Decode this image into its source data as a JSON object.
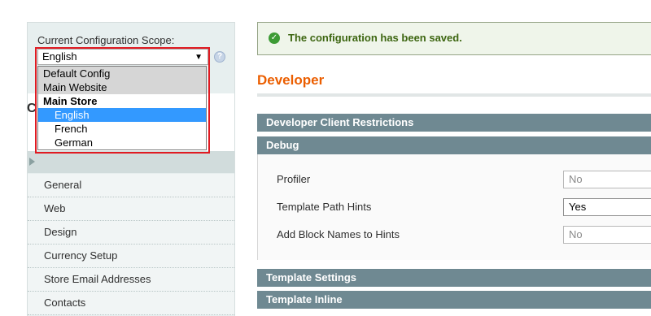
{
  "scope": {
    "label": "Current Configuration Scope:",
    "selected": "English",
    "help": "?",
    "options": [
      {
        "label": "Default Config"
      },
      {
        "label": "Main Website"
      },
      {
        "label": "Main Store"
      },
      {
        "label": "English"
      },
      {
        "label": "French"
      },
      {
        "label": "German"
      }
    ]
  },
  "sidebar": {
    "heading": "C",
    "items": [
      {
        "label": "General"
      },
      {
        "label": "Web"
      },
      {
        "label": "Design"
      },
      {
        "label": "Currency Setup"
      },
      {
        "label": "Store Email Addresses"
      },
      {
        "label": "Contacts"
      }
    ]
  },
  "message": {
    "text": "The configuration has been saved."
  },
  "page": {
    "title": "Developer"
  },
  "sections": {
    "client_restrictions": "Developer Client Restrictions",
    "debug": "Debug",
    "template_settings": "Template Settings",
    "template_inline": "Template Inline"
  },
  "debug_fields": [
    {
      "label": "Profiler",
      "value": "No"
    },
    {
      "label": "Template Path Hints",
      "value": "Yes"
    },
    {
      "label": "Add Block Names to Hints",
      "value": "No"
    }
  ],
  "colors": {
    "accent": "#eb5e00",
    "section_bar": "#6f8992",
    "highlight": "#3399ff",
    "outline": "#e01b22",
    "success": "#3d9b35"
  }
}
